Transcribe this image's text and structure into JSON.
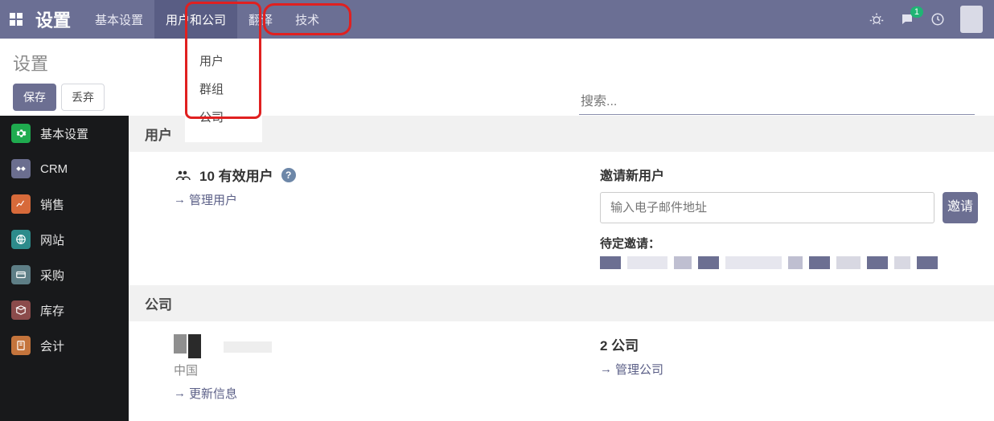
{
  "topbar": {
    "title": "设置",
    "nav": [
      "基本设置",
      "用户和公司",
      "翻译",
      "技术"
    ],
    "active_index": 1,
    "chat_badge": "1"
  },
  "dropdown": {
    "items": [
      "用户",
      "群组",
      "公司"
    ]
  },
  "breadcrumb": "设置",
  "buttons": {
    "save": "保存",
    "discard": "丢弃"
  },
  "search": {
    "placeholder": "搜索..."
  },
  "sidebar": {
    "items": [
      {
        "label": "基本设置"
      },
      {
        "label": "CRM"
      },
      {
        "label": "销售"
      },
      {
        "label": "网站"
      },
      {
        "label": "采购"
      },
      {
        "label": "库存"
      },
      {
        "label": "会计"
      }
    ]
  },
  "users_section": {
    "title": "用户",
    "count_line": "10 有效用户",
    "manage_link": "管理用户",
    "invite_title": "邀请新用户",
    "invite_placeholder": "输入电子邮件地址",
    "invite_button": "邀请",
    "pending_label": "待定邀请："
  },
  "company_section": {
    "title": "公司",
    "country": "中国",
    "update_link": "更新信息",
    "count_line": "2 公司",
    "manage_link": "管理公司"
  }
}
